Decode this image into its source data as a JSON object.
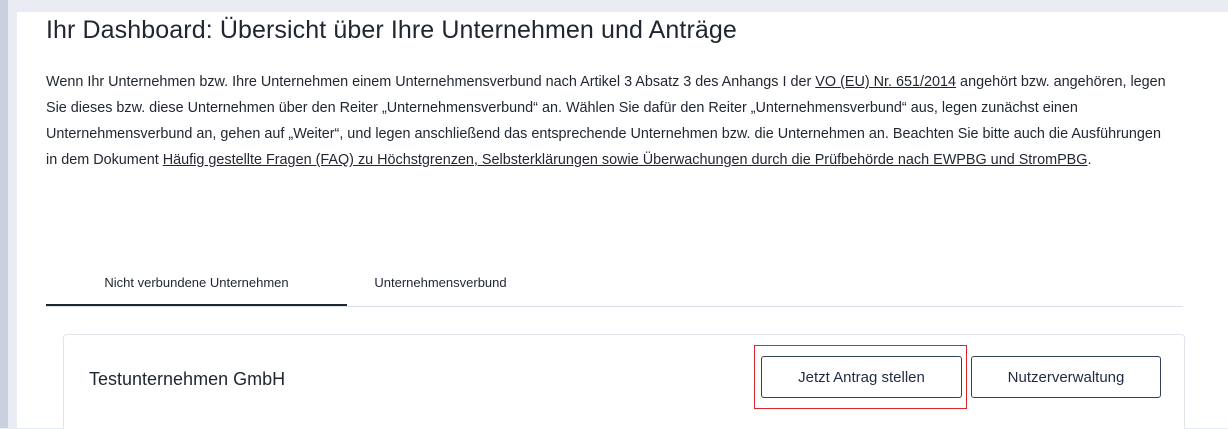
{
  "page": {
    "title": "Ihr Dashboard: Übersicht über Ihre Unternehmen und Anträge"
  },
  "intro": {
    "part1": "Wenn Ihr Unternehmen bzw. Ihre Unternehmen einem Unternehmensverbund nach Artikel 3 Absatz 3 des Anhangs I der ",
    "link_regulation": "VO (EU) Nr. 651/2014",
    "part2": " an­gehört bzw. angehören, legen Sie dieses bzw. diese Unternehmen über den Reiter „Unternehmensverbund“ an. Wählen Sie dafür den Reiter „Un­ternehmensverbund“ aus, legen zunächst einen Unternehmensverbund an, gehen auf „Weiter“, und legen anschließend das entsprechende Unter­nehmen bzw. die Unternehmen an. Beachten Sie bitte auch die Ausführungen in dem Dokument ",
    "link_faq": "Häufig gestellte Fragen (FAQ) zu Höchstgrenzen, Selbsterklärungen sowie Überwachungen durch die Prüfbehörde nach EWPBG und StromPBG",
    "part3": "."
  },
  "tabs": [
    {
      "label": "Nicht verbundene Unternehmen",
      "active": true
    },
    {
      "label": "Unternehmensverbund",
      "active": false
    }
  ],
  "company": {
    "name": "Testunternehmen GmbH",
    "apply_button": "Jetzt Antrag stellen",
    "users_button": "Nutzerverwaltung"
  },
  "colors": {
    "highlight": "#d9262b",
    "button_border": "#30415f",
    "text": "#1f2630",
    "background": "#e9ecf3"
  }
}
